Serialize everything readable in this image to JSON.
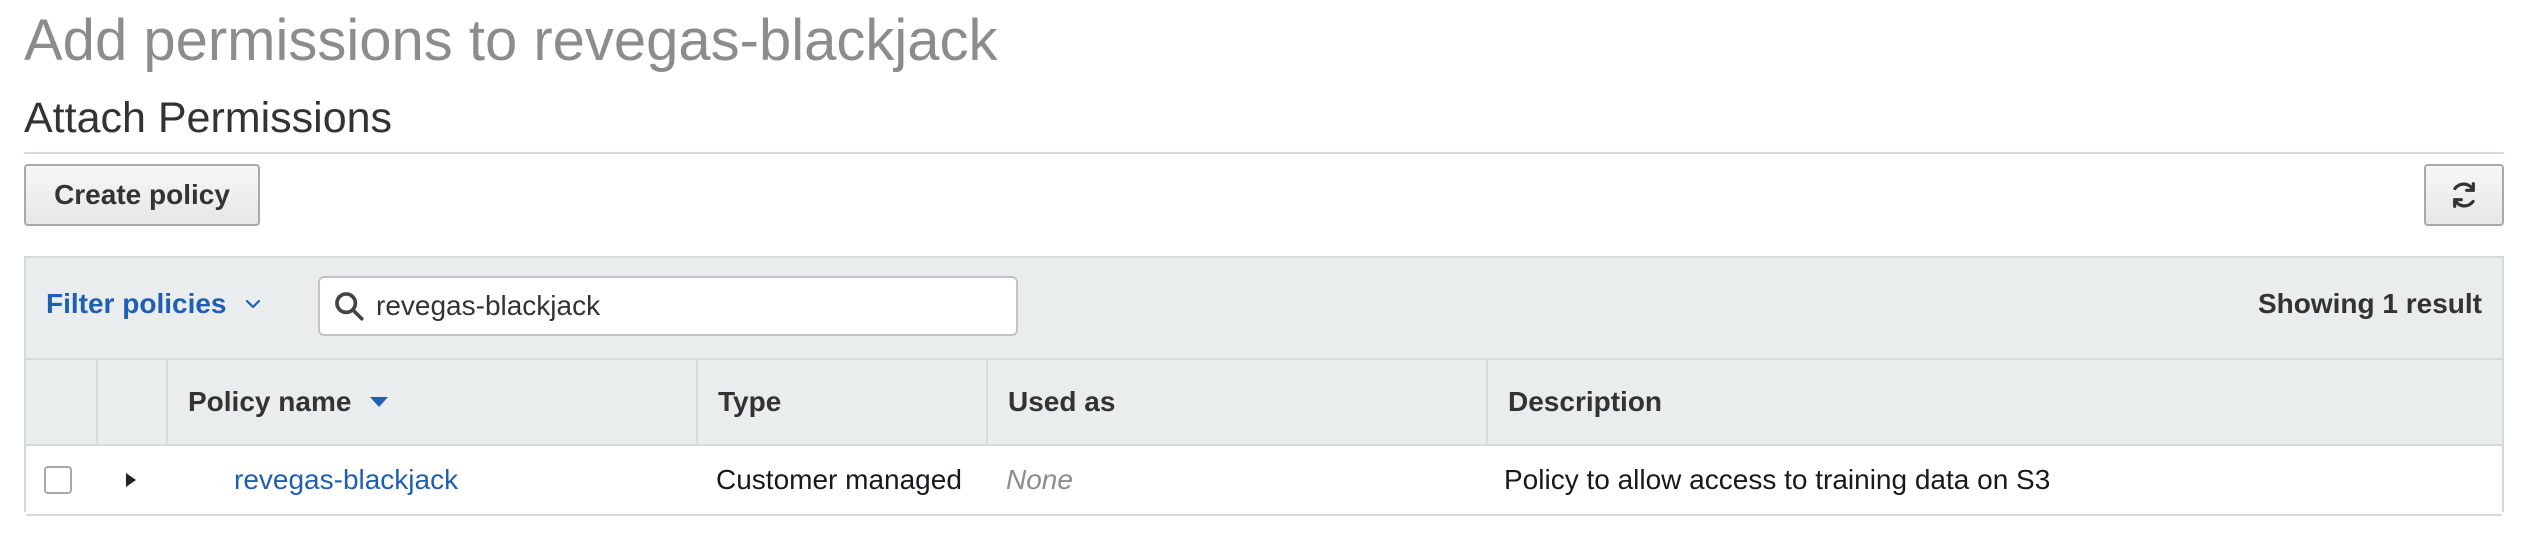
{
  "page": {
    "title": "Add permissions to revegas-blackjack",
    "section_title": "Attach Permissions"
  },
  "toolbar": {
    "create_policy_label": "Create policy",
    "refresh_icon": "refresh-icon"
  },
  "filter": {
    "label": "Filter policies",
    "search_value": "revegas-blackjack",
    "result_count": "Showing 1 result"
  },
  "table": {
    "columns": [
      {
        "label": "Policy name",
        "sorted": "descending"
      },
      {
        "label": "Type"
      },
      {
        "label": "Used as"
      },
      {
        "label": "Description"
      }
    ],
    "rows": [
      {
        "policy_name": "revegas-blackjack",
        "type": "Customer managed",
        "used_as": "None",
        "description": "Policy to allow access to training data on S3",
        "selected": false
      }
    ]
  },
  "colors": {
    "link": "#1f5fb3",
    "header_bg": "#eaeded",
    "muted_text": "#8c8c8c"
  }
}
